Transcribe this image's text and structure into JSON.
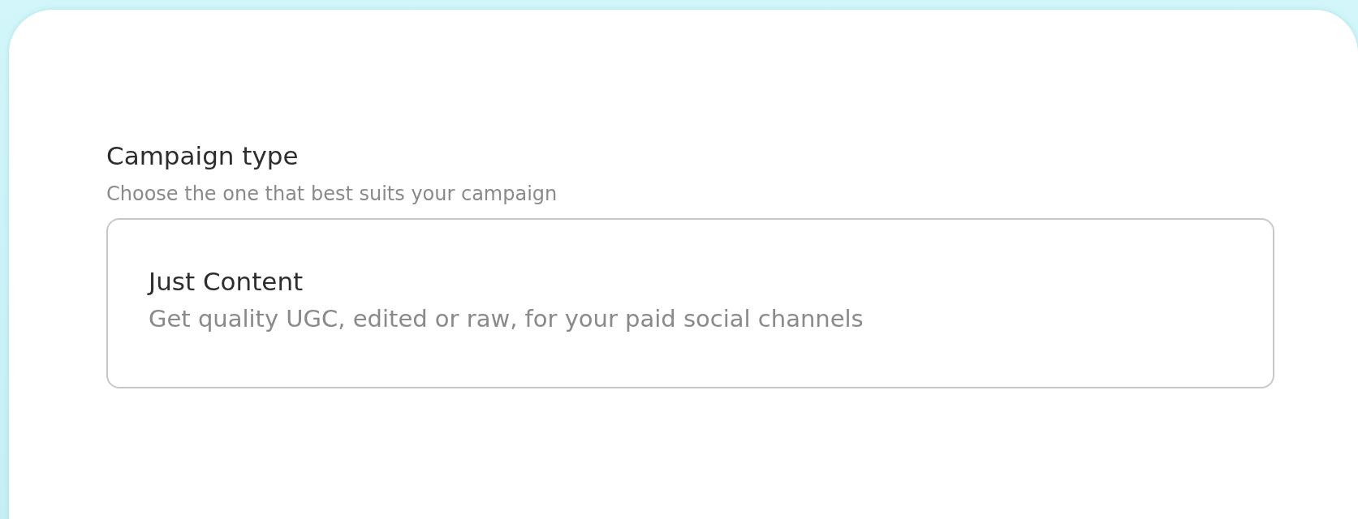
{
  "section": {
    "title": "Campaign type",
    "subtitle": "Choose the one that best suits your campaign"
  },
  "options": [
    {
      "title": "Just Content",
      "description": "Get quality UGC, edited or raw, for your paid social channels"
    }
  ]
}
